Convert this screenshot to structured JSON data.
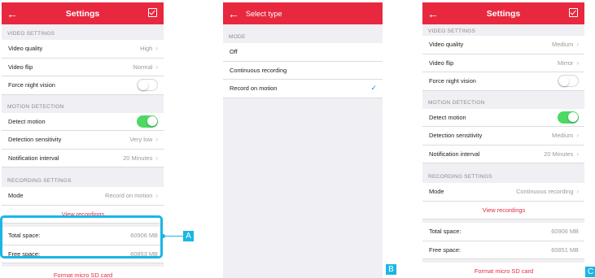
{
  "panels": {
    "A": {
      "title": "Settings",
      "video_section": "VIDEO SETTINGS",
      "video_quality": {
        "label": "Video quality",
        "value": "High"
      },
      "video_flip": {
        "label": "Video flip",
        "value": "Normal"
      },
      "night_vision": {
        "label": "Force night vision",
        "state": "off"
      },
      "motion_section": "MOTION DETECTION",
      "detect_motion": {
        "label": "Detect motion",
        "state": "on"
      },
      "sensitivity": {
        "label": "Detection sensitivity",
        "value": "Very low"
      },
      "notification": {
        "label": "Notification interval",
        "value": "20 Minutes"
      },
      "recording_section": "RECORDING SETTINGS",
      "mode": {
        "label": "Mode",
        "value": "Record on motion"
      },
      "view_recordings": "View recordings",
      "total_space": {
        "label": "Total space:",
        "value": "60906 MB"
      },
      "free_space": {
        "label": "Free space:",
        "value": "60853 MB"
      },
      "format": "Format micro SD card",
      "badge": "A"
    },
    "B": {
      "title": "Select type",
      "section": "MODE",
      "options": [
        "Off",
        "Continuous recording",
        "Record on motion"
      ],
      "selected_index": 2,
      "badge": "B"
    },
    "C": {
      "title": "Settings",
      "video_section": "VIDEO SETTINGS",
      "video_quality": {
        "label": "Video quality",
        "value": "Medium"
      },
      "video_flip": {
        "label": "Video flip",
        "value": "Mirror"
      },
      "night_vision": {
        "label": "Force night vision",
        "state": "off"
      },
      "motion_section": "MOTION DETECTION",
      "detect_motion": {
        "label": "Detect motion",
        "state": "on"
      },
      "sensitivity": {
        "label": "Detection sensitivity",
        "value": "Medium"
      },
      "notification": {
        "label": "Notification interval",
        "value": "20 Minutes"
      },
      "recording_section": "RECORDING SETTINGS",
      "mode": {
        "label": "Mode",
        "value": "Continuous recording"
      },
      "view_recordings": "View recordings",
      "total_space": {
        "label": "Total space:",
        "value": "60906 MB"
      },
      "free_space": {
        "label": "Free space:",
        "value": "60851 MB"
      },
      "format": "Format micro SD card",
      "badge": "C"
    }
  },
  "colors": {
    "header": "#e8283f",
    "toggle_on": "#4cd964",
    "highlight": "#1ab6e6",
    "link": "#e8283f",
    "check": "#1a8ae6"
  },
  "icons": {
    "back": "back-arrow-icon",
    "save": "save-check-icon",
    "chevron": "chevron-right-icon",
    "check": "checkmark-icon"
  }
}
